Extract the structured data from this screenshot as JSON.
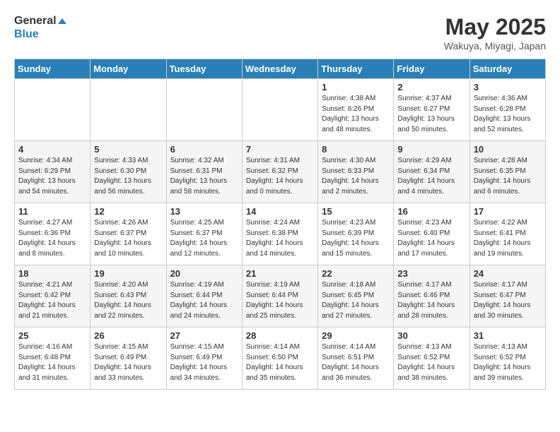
{
  "header": {
    "logo_line1": "General",
    "logo_line2": "Blue",
    "month_title": "May 2025",
    "location": "Wakuya, Miyagi, Japan"
  },
  "weekdays": [
    "Sunday",
    "Monday",
    "Tuesday",
    "Wednesday",
    "Thursday",
    "Friday",
    "Saturday"
  ],
  "weeks": [
    [
      {
        "day": "",
        "info": ""
      },
      {
        "day": "",
        "info": ""
      },
      {
        "day": "",
        "info": ""
      },
      {
        "day": "",
        "info": ""
      },
      {
        "day": "1",
        "info": "Sunrise: 4:38 AM\nSunset: 6:26 PM\nDaylight: 13 hours\nand 48 minutes."
      },
      {
        "day": "2",
        "info": "Sunrise: 4:37 AM\nSunset: 6:27 PM\nDaylight: 13 hours\nand 50 minutes."
      },
      {
        "day": "3",
        "info": "Sunrise: 4:36 AM\nSunset: 6:28 PM\nDaylight: 13 hours\nand 52 minutes."
      }
    ],
    [
      {
        "day": "4",
        "info": "Sunrise: 4:34 AM\nSunset: 6:29 PM\nDaylight: 13 hours\nand 54 minutes."
      },
      {
        "day": "5",
        "info": "Sunrise: 4:33 AM\nSunset: 6:30 PM\nDaylight: 13 hours\nand 56 minutes."
      },
      {
        "day": "6",
        "info": "Sunrise: 4:32 AM\nSunset: 6:31 PM\nDaylight: 13 hours\nand 58 minutes."
      },
      {
        "day": "7",
        "info": "Sunrise: 4:31 AM\nSunset: 6:32 PM\nDaylight: 14 hours\nand 0 minutes."
      },
      {
        "day": "8",
        "info": "Sunrise: 4:30 AM\nSunset: 6:33 PM\nDaylight: 14 hours\nand 2 minutes."
      },
      {
        "day": "9",
        "info": "Sunrise: 4:29 AM\nSunset: 6:34 PM\nDaylight: 14 hours\nand 4 minutes."
      },
      {
        "day": "10",
        "info": "Sunrise: 4:28 AM\nSunset: 6:35 PM\nDaylight: 14 hours\nand 6 minutes."
      }
    ],
    [
      {
        "day": "11",
        "info": "Sunrise: 4:27 AM\nSunset: 6:36 PM\nDaylight: 14 hours\nand 8 minutes."
      },
      {
        "day": "12",
        "info": "Sunrise: 4:26 AM\nSunset: 6:37 PM\nDaylight: 14 hours\nand 10 minutes."
      },
      {
        "day": "13",
        "info": "Sunrise: 4:25 AM\nSunset: 6:37 PM\nDaylight: 14 hours\nand 12 minutes."
      },
      {
        "day": "14",
        "info": "Sunrise: 4:24 AM\nSunset: 6:38 PM\nDaylight: 14 hours\nand 14 minutes."
      },
      {
        "day": "15",
        "info": "Sunrise: 4:23 AM\nSunset: 6:39 PM\nDaylight: 14 hours\nand 15 minutes."
      },
      {
        "day": "16",
        "info": "Sunrise: 4:23 AM\nSunset: 6:40 PM\nDaylight: 14 hours\nand 17 minutes."
      },
      {
        "day": "17",
        "info": "Sunrise: 4:22 AM\nSunset: 6:41 PM\nDaylight: 14 hours\nand 19 minutes."
      }
    ],
    [
      {
        "day": "18",
        "info": "Sunrise: 4:21 AM\nSunset: 6:42 PM\nDaylight: 14 hours\nand 21 minutes."
      },
      {
        "day": "19",
        "info": "Sunrise: 4:20 AM\nSunset: 6:43 PM\nDaylight: 14 hours\nand 22 minutes."
      },
      {
        "day": "20",
        "info": "Sunrise: 4:19 AM\nSunset: 6:44 PM\nDaylight: 14 hours\nand 24 minutes."
      },
      {
        "day": "21",
        "info": "Sunrise: 4:19 AM\nSunset: 6:44 PM\nDaylight: 14 hours\nand 25 minutes."
      },
      {
        "day": "22",
        "info": "Sunrise: 4:18 AM\nSunset: 6:45 PM\nDaylight: 14 hours\nand 27 minutes."
      },
      {
        "day": "23",
        "info": "Sunrise: 4:17 AM\nSunset: 6:46 PM\nDaylight: 14 hours\nand 28 minutes."
      },
      {
        "day": "24",
        "info": "Sunrise: 4:17 AM\nSunset: 6:47 PM\nDaylight: 14 hours\nand 30 minutes."
      }
    ],
    [
      {
        "day": "25",
        "info": "Sunrise: 4:16 AM\nSunset: 6:48 PM\nDaylight: 14 hours\nand 31 minutes."
      },
      {
        "day": "26",
        "info": "Sunrise: 4:15 AM\nSunset: 6:49 PM\nDaylight: 14 hours\nand 33 minutes."
      },
      {
        "day": "27",
        "info": "Sunrise: 4:15 AM\nSunset: 6:49 PM\nDaylight: 14 hours\nand 34 minutes."
      },
      {
        "day": "28",
        "info": "Sunrise: 4:14 AM\nSunset: 6:50 PM\nDaylight: 14 hours\nand 35 minutes."
      },
      {
        "day": "29",
        "info": "Sunrise: 4:14 AM\nSunset: 6:51 PM\nDaylight: 14 hours\nand 36 minutes."
      },
      {
        "day": "30",
        "info": "Sunrise: 4:13 AM\nSunset: 6:52 PM\nDaylight: 14 hours\nand 38 minutes."
      },
      {
        "day": "31",
        "info": "Sunrise: 4:13 AM\nSunset: 6:52 PM\nDaylight: 14 hours\nand 39 minutes."
      }
    ]
  ]
}
